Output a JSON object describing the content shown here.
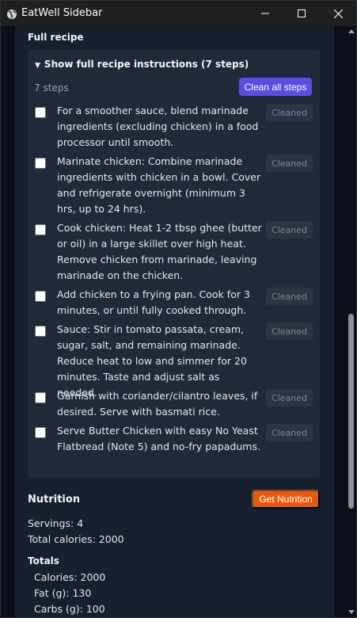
{
  "window": {
    "title": "EatWell Sidebar"
  },
  "recipe": {
    "section_title": "Full recipe",
    "summary": "Show full recipe instructions (7 steps)",
    "steps_count": "7 steps",
    "clean_all_label": "Clean all steps",
    "cleaned_label": "Cleaned",
    "steps": [
      {
        "text": "For a smoother sauce, blend marinade ingredients (excluding chicken) in a food processor until smooth.",
        "checked": false
      },
      {
        "text": "Marinate chicken: Combine marinade ingredients with chicken in a bowl. Cover and refrigerate overnight (minimum 3 hrs, up to 24 hrs).",
        "checked": false
      },
      {
        "text": "Cook chicken: Heat 1-2 tbsp ghee (butter or oil) in a large skillet over high heat. Remove chicken from marinade, leaving marinade on the chicken.",
        "checked": false
      },
      {
        "text": "Add chicken to a frying pan. Cook for 3 minutes, or until fully cooked through.",
        "checked": false
      },
      {
        "text": "Sauce: Stir in tomato passata, cream, sugar, salt, and remaining marinade. Reduce heat to low and simmer for 20 minutes. Taste and adjust salt as needed.",
        "checked": false
      },
      {
        "text": "Garnish with coriander/cilantro leaves, if desired. Serve with basmati rice.",
        "checked": false
      },
      {
        "text": "Serve Butter Chicken with easy No Yeast Flatbread (Note 5) and no-fry papadums.",
        "checked": false
      }
    ]
  },
  "nutrition": {
    "section_title": "Nutrition",
    "get_label": "Get Nutrition",
    "servings": "Servings: 4",
    "total_calories": "Total calories: 2000",
    "totals_title": "Totals",
    "totals": [
      "Calories: 2000",
      "Fat (g): 130",
      "Carbs (g): 100"
    ]
  },
  "colors": {
    "accent_purple": "#5b4de0",
    "accent_orange": "#ea580c",
    "panel": "#1f2937",
    "background": "#161f2e"
  },
  "icons": [
    "globe-icon",
    "minimize-icon",
    "maximize-icon",
    "close-icon",
    "scroll-up-arrow",
    "scroll-down-arrow"
  ]
}
